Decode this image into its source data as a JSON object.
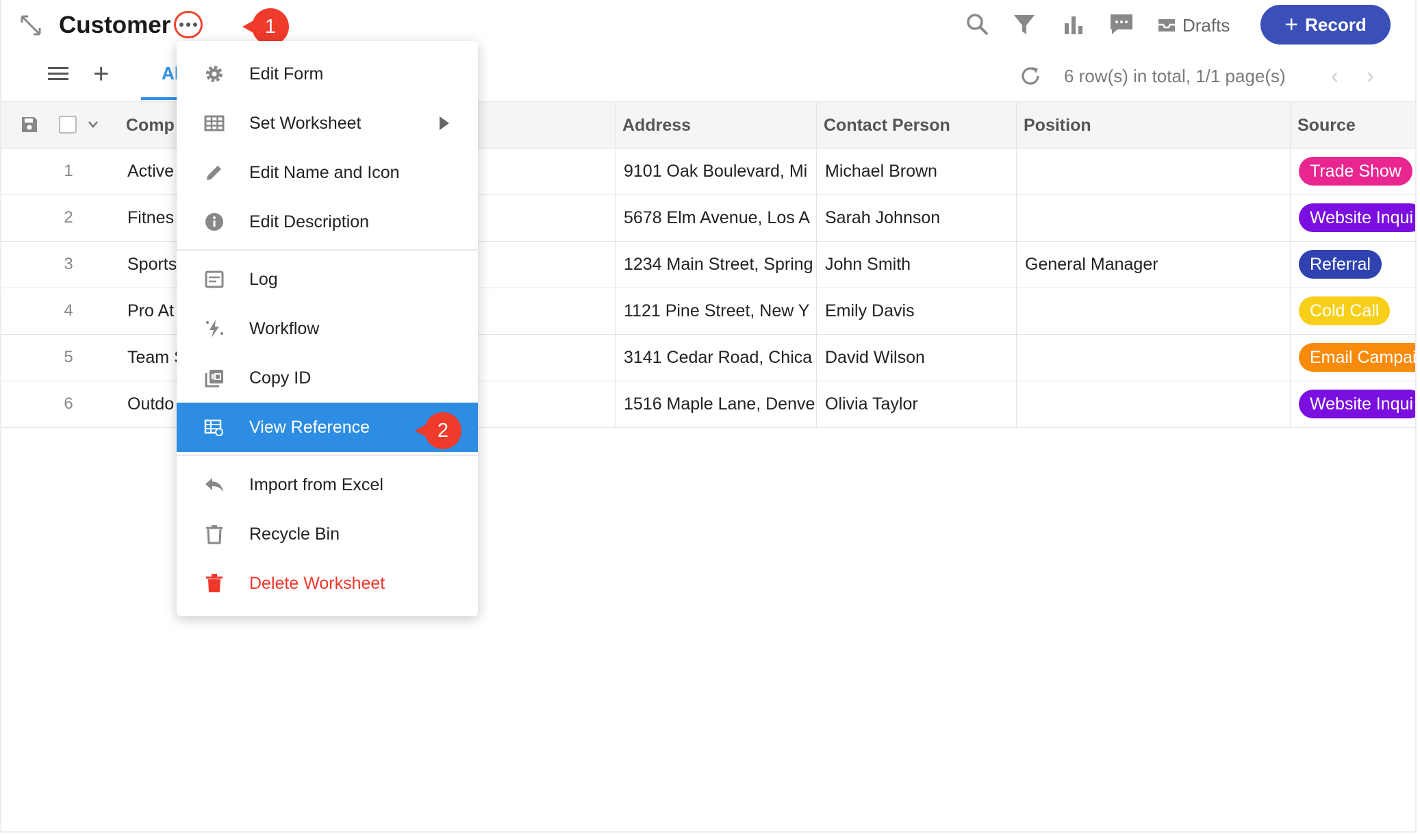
{
  "header": {
    "title": "Customer",
    "drafts_label": "Drafts",
    "record_button_label": "Record",
    "record_button_plus": "+"
  },
  "callouts": {
    "one": "1",
    "two": "2"
  },
  "toolbar": {
    "add_view": "+",
    "tab_all_label": "Al",
    "pagination_text": "6 row(s) in total, 1/1 page(s)",
    "prev": "‹",
    "next": "›"
  },
  "table": {
    "columns": {
      "company": "Comp",
      "address": "Address",
      "contact": "Contact Person",
      "position": "Position",
      "source": "Source"
    },
    "rows": [
      {
        "num": "1",
        "company": "Active",
        "address": "9101 Oak Boulevard, Mi",
        "contact": "Michael Brown",
        "position": "",
        "source": "Trade Show"
      },
      {
        "num": "2",
        "company": "Fitnes",
        "address": "5678 Elm Avenue, Los A",
        "contact": "Sarah Johnson",
        "position": "",
        "source": "Website Inqui"
      },
      {
        "num": "3",
        "company": "Sports",
        "address": "1234 Main Street, Spring",
        "contact": "John Smith",
        "position": "General Manager",
        "source": "Referral"
      },
      {
        "num": "4",
        "company": "Pro At",
        "address": "1121 Pine Street, New Y",
        "contact": "Emily Davis",
        "position": "",
        "source": "Cold Call"
      },
      {
        "num": "5",
        "company": "Team S",
        "address": "3141 Cedar Road, Chica",
        "contact": "David Wilson",
        "position": "",
        "source": "Email Campai"
      },
      {
        "num": "6",
        "company": "Outdo",
        "address": "1516 Maple Lane, Denve",
        "contact": "Olivia Taylor",
        "position": "",
        "source": "Website Inqui"
      }
    ],
    "source_colors": {
      "Trade Show": "#e9268f",
      "Website Inqui": "#7a0fe0",
      "Referral": "#2f42b0",
      "Cold Call": "#f8cf18",
      "Email Campai": "#f88a0c"
    }
  },
  "menu": {
    "items": [
      {
        "label": "Edit Form",
        "icon": "gear-icon"
      },
      {
        "label": "Set Worksheet",
        "icon": "table-grid-icon"
      },
      {
        "label": "Edit Name and Icon",
        "icon": "pencil-icon"
      },
      {
        "label": "Edit Description",
        "icon": "info-icon"
      },
      {
        "label": "Log",
        "icon": "log-icon"
      },
      {
        "label": "Workflow",
        "icon": "workflow-icon"
      },
      {
        "label": "Copy ID",
        "icon": "copy-id-icon"
      },
      {
        "label": "View Reference",
        "icon": "reference-icon"
      },
      {
        "label": "Import from Excel",
        "icon": "reply-arrow-icon"
      },
      {
        "label": "Recycle Bin",
        "icon": "trash-outline-icon"
      },
      {
        "label": "Delete Worksheet",
        "icon": "trash-filled-icon"
      }
    ],
    "accent_color": "#2c8de3",
    "danger_color": "#f0372a"
  }
}
